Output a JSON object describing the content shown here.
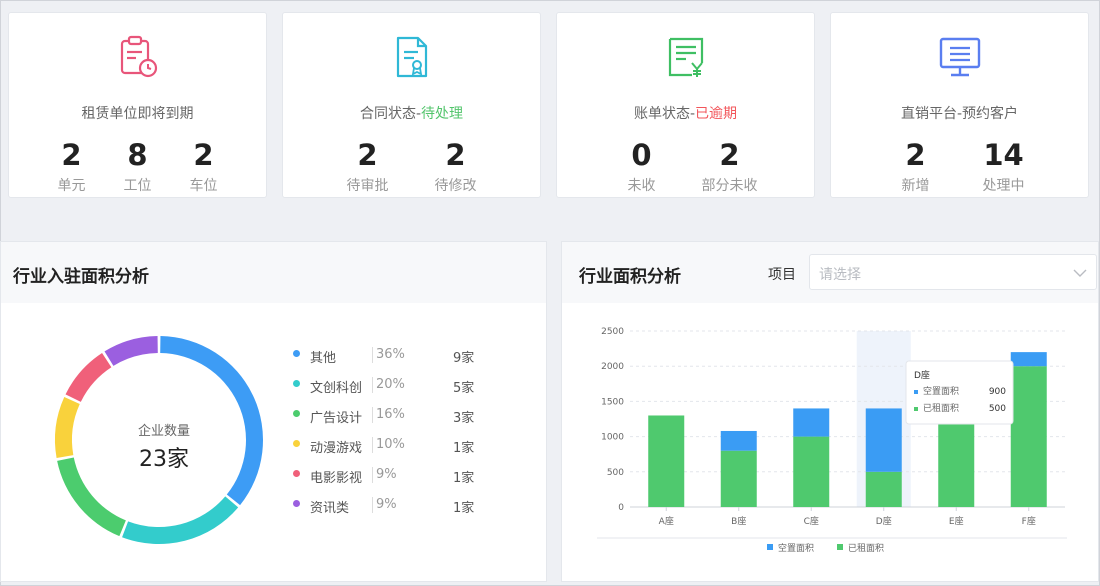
{
  "cards": [
    {
      "title": "租赁单位即将到期",
      "stats": [
        {
          "value": "2",
          "label": "单元"
        },
        {
          "value": "8",
          "label": "工位"
        },
        {
          "value": "2",
          "label": "车位"
        }
      ],
      "icon": "clipboard-clock-icon",
      "color": "#e8557a"
    },
    {
      "title_prefix": "合同状态-",
      "title_highlight": "待处理",
      "stats": [
        {
          "value": "2",
          "label": "待审批"
        },
        {
          "value": "2",
          "label": "待修改"
        }
      ],
      "icon": "contract-doc-icon",
      "color": "#2fb8d6"
    },
    {
      "title_prefix": "账单状态-",
      "title_highlight": "已逾期",
      "stats": [
        {
          "value": "0",
          "label": "未收"
        },
        {
          "value": "2",
          "label": "部分未收"
        }
      ],
      "icon": "bill-yen-icon",
      "color": "#3fbf63"
    },
    {
      "title": "直销平台-预约客户",
      "stats": [
        {
          "value": "2",
          "label": "新增"
        },
        {
          "value": "14",
          "label": "处理中"
        }
      ],
      "icon": "monitor-icon",
      "color": "#5a7ef0"
    }
  ],
  "industry_panel": {
    "title": "行业入驻面积分析",
    "center_label": "企业数量",
    "center_value": "23家"
  },
  "area_panel": {
    "title": "行业面积分析",
    "project_label": "项目",
    "select_placeholder": "请选择"
  },
  "chart_data": [
    {
      "type": "pie",
      "categories": [
        "其他",
        "文创科创",
        "广告设计",
        "动漫游戏",
        "电影影视",
        "资讯类"
      ],
      "values": [
        36,
        20,
        16,
        10,
        9,
        9
      ],
      "percent_labels": [
        "36%",
        "20%",
        "16%",
        "10%",
        "9%",
        "9%"
      ],
      "count_labels": [
        "9家",
        "5家",
        "3家",
        "1家",
        "1家",
        "1家"
      ],
      "colors": [
        "#3d9cf5",
        "#33cccc",
        "#4ccc6e",
        "#f9d23c",
        "#f0607a",
        "#9b5fe0"
      ]
    },
    {
      "type": "bar",
      "stacked": true,
      "categories": [
        "A座",
        "B座",
        "C座",
        "D座",
        "E座",
        "F座"
      ],
      "series": [
        {
          "name": "已租面积",
          "values": [
            1300,
            800,
            1000,
            500,
            1950,
            2000
          ],
          "color": "#4fc96e"
        },
        {
          "name": "空置面积",
          "values": [
            0,
            280,
            400,
            900,
            0,
            200
          ],
          "color": "#3a9cf4"
        }
      ],
      "ylim": [
        0,
        2500
      ],
      "yticks": [
        "0",
        "500",
        "1000",
        "1500",
        "2000",
        "2500"
      ],
      "legend_position": "bottom",
      "tooltip": {
        "title": "D座",
        "rows": [
          {
            "name": "空置面积",
            "value": "900"
          },
          {
            "name": "已租面积",
            "value": "500"
          }
        ]
      }
    }
  ]
}
